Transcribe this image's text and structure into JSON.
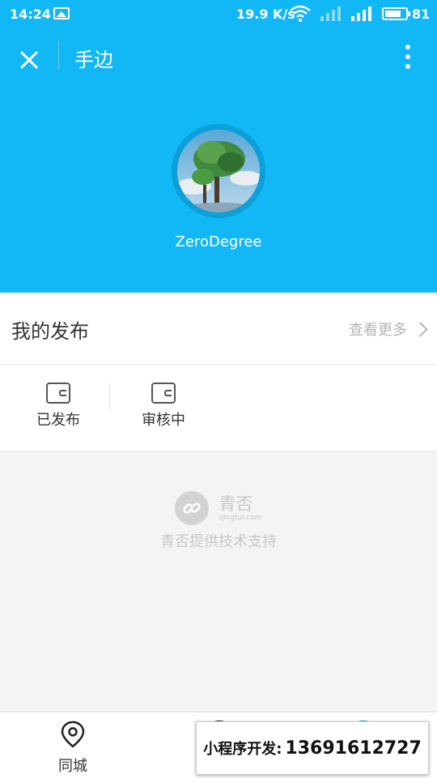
{
  "status_bar": {
    "time": "14:24",
    "speed": "19.9 K/s",
    "network": "4G",
    "battery": "81",
    "battery_level": 0.81
  },
  "header": {
    "title": "手边",
    "username": "ZeroDegree",
    "background_color": "#12b7f5"
  },
  "my_posts": {
    "title": "我的发布",
    "see_more": "查看更多",
    "tabs": [
      {
        "label": "已发布",
        "icon": "wallet-icon"
      },
      {
        "label": "审核中",
        "icon": "wallet-icon"
      }
    ]
  },
  "brand": {
    "name": "青否",
    "domain": "qingful.com",
    "support_text": "青否提供技术支持"
  },
  "bottom_nav": {
    "items": [
      {
        "label": "同城",
        "icon": "location-pin-icon"
      }
    ]
  },
  "ad": {
    "label": "小程序开发:",
    "phone": "13691612727"
  }
}
